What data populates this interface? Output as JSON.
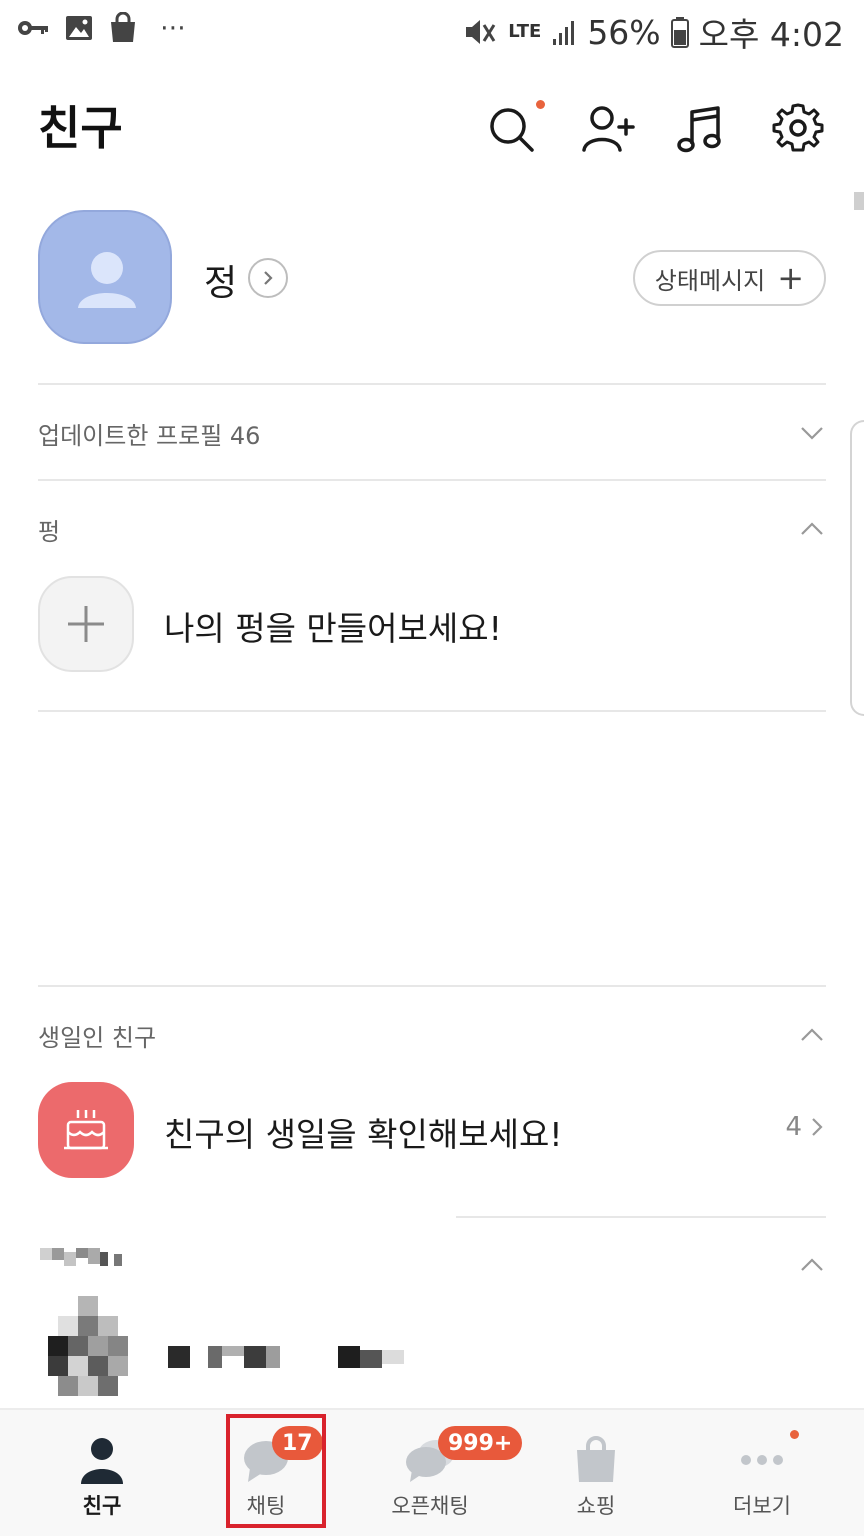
{
  "status_bar": {
    "battery": "56%",
    "time": "오후 4:02",
    "network": "LTE",
    "left_icons": [
      "key-icon",
      "image-icon",
      "shopping-bag-icon"
    ],
    "more": "⋯"
  },
  "header": {
    "title": "친구",
    "icons": [
      "search-icon",
      "add-friend-icon",
      "music-icon",
      "settings-icon"
    ]
  },
  "profile": {
    "name": "정",
    "status_button": "상태메시지"
  },
  "updated_profiles": {
    "label": "업데이트한 프로필 46",
    "collapsed": true
  },
  "pung": {
    "label": "펑",
    "create_text": "나의 펑을 만들어보세요!"
  },
  "birthday": {
    "label": "생일인 친구",
    "text": "친구의 생일을 확인해보세요!",
    "count": "4"
  },
  "bottom_nav": {
    "tabs": [
      {
        "label": "친구",
        "icon": "person-icon",
        "active": true
      },
      {
        "label": "채팅",
        "icon": "chat-icon",
        "badge": "17"
      },
      {
        "label": "오픈채팅",
        "icon": "open-chat-icon",
        "badge": "999+"
      },
      {
        "label": "쇼핑",
        "icon": "shopping-bag-icon"
      },
      {
        "label": "더보기",
        "icon": "more-icon",
        "dot": true
      }
    ]
  },
  "colors": {
    "accent": "#e8593b",
    "avatar": "#a3b8e8",
    "birthday_tile": "#ec6a6c",
    "highlight": "#d9232d"
  }
}
